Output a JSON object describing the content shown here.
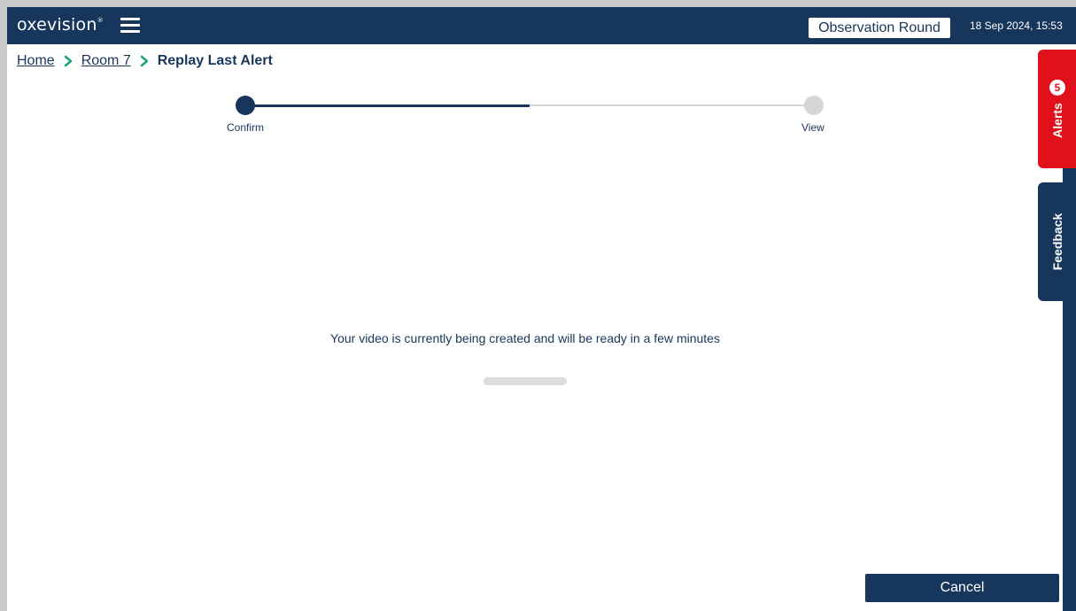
{
  "header": {
    "logo_text": "oxevision",
    "logo_mark": "®",
    "menu_icon": "hamburger-menu-icon",
    "observation_round_label": "Observation Round",
    "datetime": "18 Sep 2024, 15:53"
  },
  "breadcrumb": {
    "items": [
      "Home",
      "Room 7"
    ],
    "current": "Replay Last Alert",
    "separator_icon": "chevron-right-icon",
    "separator_color": "#1aa37a"
  },
  "stepper": {
    "steps": [
      "Confirm",
      "View"
    ],
    "progress_fraction": 0.5
  },
  "main": {
    "status_message": "Your video is currently being created and will be ready in a few minutes",
    "loader_icon": "loading-bar"
  },
  "side_tabs": {
    "alerts_label": "Alerts",
    "alerts_count": "5",
    "feedback_label": "Feedback"
  },
  "footer": {
    "cancel_label": "Cancel"
  },
  "colors": {
    "primary": "#17365c",
    "alert": "#e0111b",
    "accent": "#1aa37a",
    "inactive": "#d6d6d6"
  }
}
